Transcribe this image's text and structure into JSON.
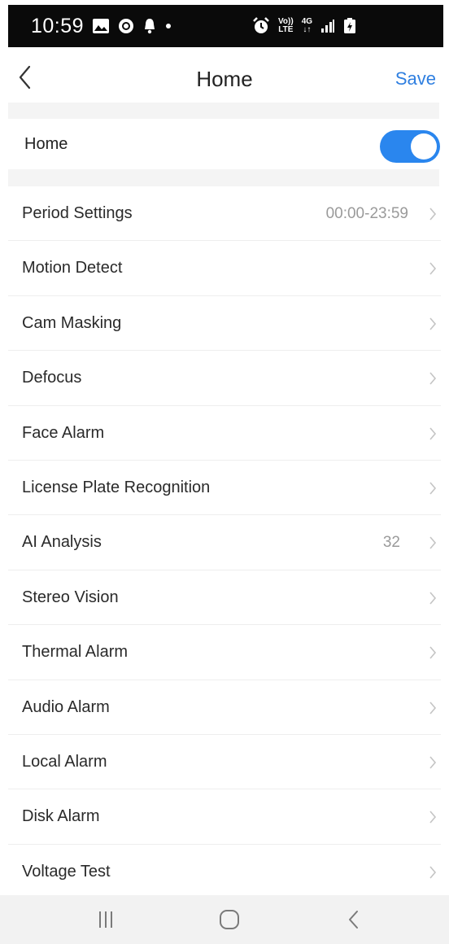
{
  "status_bar": {
    "time": "10:59",
    "left_icons": [
      "gallery-icon",
      "record-icon",
      "notification-bell-icon",
      "dot-icon"
    ],
    "right_icons": [
      "alarm-icon",
      "volte-icon",
      "4g-data-icon",
      "signal-icon",
      "battery-charging-icon"
    ],
    "volte_top": "Vo))",
    "volte_bottom": "LTE",
    "data_top": "4G",
    "data_bottom": "↓↑"
  },
  "header": {
    "title": "Home",
    "save_label": "Save",
    "accent_color": "#2f7fe0"
  },
  "toggle": {
    "label": "Home",
    "state": "on",
    "color": "#2a86ee"
  },
  "settings": {
    "items": [
      {
        "label": "Period Settings",
        "value": "00:00-23:59"
      },
      {
        "label": "Motion Detect",
        "value": ""
      },
      {
        "label": "Cam Masking",
        "value": ""
      },
      {
        "label": "Defocus",
        "value": ""
      },
      {
        "label": "Face Alarm",
        "value": ""
      },
      {
        "label": "License Plate Recognition",
        "value": ""
      },
      {
        "label": "AI Analysis",
        "value": "32"
      },
      {
        "label": "Stereo Vision",
        "value": ""
      },
      {
        "label": "Thermal Alarm",
        "value": ""
      },
      {
        "label": "Audio Alarm",
        "value": ""
      },
      {
        "label": "Local Alarm",
        "value": ""
      },
      {
        "label": "Disk Alarm",
        "value": ""
      },
      {
        "label": "Voltage Test",
        "value": ""
      }
    ]
  },
  "system_nav": {
    "icons": [
      "recent-apps-icon",
      "home-icon",
      "back-icon"
    ]
  }
}
